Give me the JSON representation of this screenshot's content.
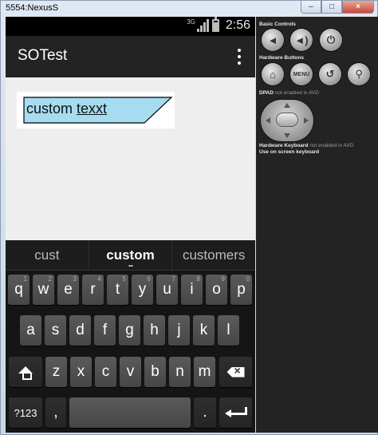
{
  "window": {
    "title": "5554:NexusS",
    "min_glyph": "–",
    "max_glyph": "□",
    "close_glyph": "×"
  },
  "status_bar": {
    "network": "3G",
    "time": "2:56"
  },
  "action_bar": {
    "title": "SOTest"
  },
  "edit_text": {
    "word1": "custom",
    "word2": "texxt",
    "fill_color": "#a6dcef"
  },
  "keyboard": {
    "suggestions": [
      "cust",
      "custom",
      "customers"
    ],
    "row1": [
      {
        "label": "q",
        "hint": "1"
      },
      {
        "label": "w",
        "hint": "2"
      },
      {
        "label": "e",
        "hint": "3"
      },
      {
        "label": "r",
        "hint": "4"
      },
      {
        "label": "t",
        "hint": "5"
      },
      {
        "label": "y",
        "hint": "6"
      },
      {
        "label": "u",
        "hint": "7"
      },
      {
        "label": "i",
        "hint": "8"
      },
      {
        "label": "o",
        "hint": "9"
      },
      {
        "label": "p",
        "hint": "0"
      }
    ],
    "row2": [
      "a",
      "s",
      "d",
      "f",
      "g",
      "h",
      "j",
      "k",
      "l"
    ],
    "row3": [
      "z",
      "x",
      "c",
      "v",
      "b",
      "n",
      "m"
    ],
    "symbols_label": "?123",
    "comma_label": ",",
    "period_label": "."
  },
  "controls": {
    "basic_label": "Basic Controls",
    "hardware_label": "Hardware Buttons",
    "menu_label": "MENU",
    "dpad_label": "DPAD",
    "dpad_note": "not enabled in AVD",
    "keyboard_label": "Hardware Keyboard",
    "keyboard_note": "not enabled in AVD",
    "keyboard_note2": "Use on screen keyboard"
  }
}
